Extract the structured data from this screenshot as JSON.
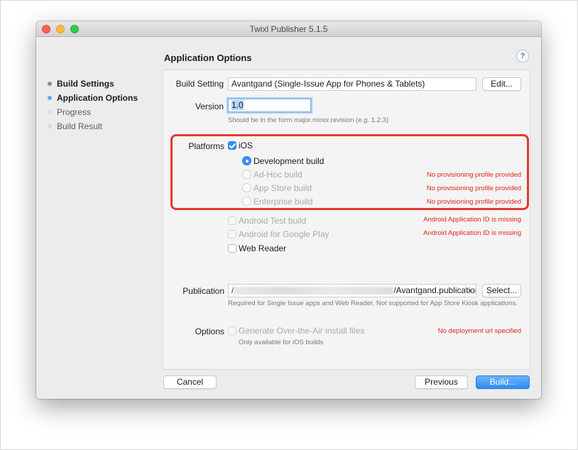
{
  "window": {
    "title": "Twixl Publisher 5.1.5"
  },
  "sidebar": {
    "items": [
      {
        "label": "Build Settings",
        "state": "done"
      },
      {
        "label": "Application Options",
        "state": "active"
      },
      {
        "label": "Progress",
        "state": "pending"
      },
      {
        "label": "Build Result",
        "state": "pending"
      }
    ]
  },
  "page": {
    "title": "Application Options",
    "help_label": "?"
  },
  "build_setting": {
    "label": "Build Setting",
    "value": "Avantgand (Single-Issue App for Phones & Tablets)",
    "edit_button": "Edit..."
  },
  "version": {
    "label": "Version",
    "value": "1.0",
    "hint": "Should be in the form major.minor.revision (e.g. 1.2.3)"
  },
  "platforms": {
    "label": "Platforms",
    "ios": {
      "label": "iOS",
      "checked": true
    },
    "ios_builds": [
      {
        "label": "Development build",
        "selected": true,
        "enabled": true,
        "warning": ""
      },
      {
        "label": "Ad-Hoc build",
        "selected": false,
        "enabled": false,
        "warning": "No provisioning profile provided"
      },
      {
        "label": "App Store build",
        "selected": false,
        "enabled": false,
        "warning": "No provisioning profile provided"
      },
      {
        "label": "Enterprise build",
        "selected": false,
        "enabled": false,
        "warning": "No provisioning profile provided"
      }
    ],
    "android_test": {
      "label": "Android Test build",
      "checked": false,
      "enabled": false,
      "warning": "Android Application ID is missing"
    },
    "android_play": {
      "label": "Android for Google Play",
      "checked": false,
      "enabled": false,
      "warning": "Android Application ID is missing"
    },
    "web_reader": {
      "label": "Web Reader",
      "checked": false,
      "enabled": true
    }
  },
  "publication": {
    "label": "Publication",
    "path_prefix": "/",
    "path_suffix": "/Avantgand.publication",
    "select_button": "Select...",
    "hint": "Required for Single Issue apps and Web Reader. Not supported for App Store Kiosk applications."
  },
  "options": {
    "label": "Options",
    "ota": {
      "label": "Generate Over-the-Air install files",
      "checked": false,
      "enabled": false
    },
    "hint": "Only available for iOS builds",
    "warning": "No deployment url specified"
  },
  "footer": {
    "cancel": "Cancel",
    "previous": "Previous",
    "build": "Build..."
  },
  "colors": {
    "accent": "#3a8ef5",
    "warning": "#e0261b",
    "highlight_frame": "#e23b2e"
  }
}
